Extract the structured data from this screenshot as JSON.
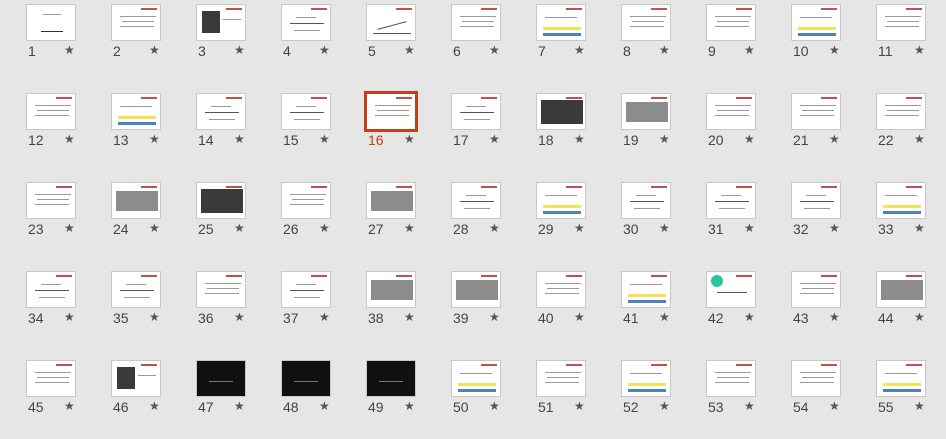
{
  "colors": {
    "background": "#e6e6e6",
    "accent": "#c43e1c",
    "title_red": "#c0504d"
  },
  "selected_slide": 16,
  "star_glyph": "★",
  "slides": [
    {
      "num": "1",
      "kind": "cover"
    },
    {
      "num": "2",
      "kind": "text"
    },
    {
      "num": "3",
      "kind": "photo"
    },
    {
      "num": "4",
      "kind": "diagram"
    },
    {
      "num": "5",
      "kind": "chart"
    },
    {
      "num": "6",
      "kind": "text"
    },
    {
      "num": "7",
      "kind": "bar"
    },
    {
      "num": "8",
      "kind": "text"
    },
    {
      "num": "9",
      "kind": "text"
    },
    {
      "num": "10",
      "kind": "bar"
    },
    {
      "num": "11",
      "kind": "text"
    },
    {
      "num": "12",
      "kind": "text"
    },
    {
      "num": "13",
      "kind": "bar"
    },
    {
      "num": "14",
      "kind": "diagram"
    },
    {
      "num": "15",
      "kind": "diagram"
    },
    {
      "num": "16",
      "kind": "text"
    },
    {
      "num": "17",
      "kind": "diagram"
    },
    {
      "num": "18",
      "kind": "dark"
    },
    {
      "num": "19",
      "kind": "gray"
    },
    {
      "num": "20",
      "kind": "text"
    },
    {
      "num": "21",
      "kind": "text"
    },
    {
      "num": "22",
      "kind": "text"
    },
    {
      "num": "23",
      "kind": "text"
    },
    {
      "num": "24",
      "kind": "gray"
    },
    {
      "num": "25",
      "kind": "dark"
    },
    {
      "num": "26",
      "kind": "text"
    },
    {
      "num": "27",
      "kind": "gray"
    },
    {
      "num": "28",
      "kind": "diagram"
    },
    {
      "num": "29",
      "kind": "bar"
    },
    {
      "num": "30",
      "kind": "diagram"
    },
    {
      "num": "31",
      "kind": "diagram"
    },
    {
      "num": "32",
      "kind": "diagram"
    },
    {
      "num": "33",
      "kind": "bar"
    },
    {
      "num": "34",
      "kind": "diagram"
    },
    {
      "num": "35",
      "kind": "diagram"
    },
    {
      "num": "36",
      "kind": "text"
    },
    {
      "num": "37",
      "kind": "diagram"
    },
    {
      "num": "38",
      "kind": "gray"
    },
    {
      "num": "39",
      "kind": "gray"
    },
    {
      "num": "40",
      "kind": "text"
    },
    {
      "num": "41",
      "kind": "bar"
    },
    {
      "num": "42",
      "kind": "blob"
    },
    {
      "num": "43",
      "kind": "text"
    },
    {
      "num": "44",
      "kind": "gray"
    },
    {
      "num": "45",
      "kind": "text"
    },
    {
      "num": "46",
      "kind": "photo"
    },
    {
      "num": "47",
      "kind": "black"
    },
    {
      "num": "48",
      "kind": "black"
    },
    {
      "num": "49",
      "kind": "black"
    },
    {
      "num": "50",
      "kind": "bar"
    },
    {
      "num": "51",
      "kind": "text"
    },
    {
      "num": "52",
      "kind": "bar"
    },
    {
      "num": "53",
      "kind": "text"
    },
    {
      "num": "54",
      "kind": "text"
    },
    {
      "num": "55",
      "kind": "bar"
    }
  ]
}
